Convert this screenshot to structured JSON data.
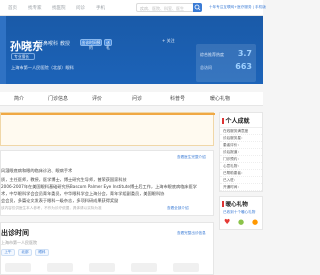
{
  "nav": {
    "items": [
      "首页",
      "找专家",
      "找医院",
      "问诊",
      "手机"
    ],
    "search_placeholder": "疾病、医院、科室、医生",
    "right_links": "十年专注互联网+医疗服务 | 手机版"
  },
  "header": {
    "name": "孙晓东",
    "dept": "耳鼻喉科",
    "title": "教授",
    "badge_visit": "出诊时间预约",
    "badge_gift": "送礼",
    "specialty": "专业擅长",
    "hospital": "上海市第一人民医院（北部）眼科",
    "focus_label": "关注",
    "stats": [
      {
        "label": "综合推荐热度",
        "value": "3.7"
      },
      {
        "label": "总访问",
        "value": "663"
      }
    ]
  },
  "tabs": [
    "简介",
    "门诊信息",
    "评价",
    "问诊",
    "科普号",
    "暖心礼物"
  ],
  "intro": {
    "more": "查看医生完整介绍",
    "lines": [
      "风湿眼底病和眼的临床诊治、眼病手术",
      "质，主任医师，教授，医学博士，博士研究生导师，曾荣获国家科技",
      "2006-2007年在美国眼科基础研究所Bascom Palmer Eye Institute博士后工作，上海市眼底病临床医学",
      "术，中华眼科学会会员青年委员，中华眼科学会上海分会，青年学组副委员，美国眼科协",
      "会会员，多篇论文发表于眼科一级杂志，多项科研成果获得奖励"
    ],
    "faint": "该内容仅供医生本人参考，不作为诊疗依据，具体请以实际为准",
    "more2": "查看全部介绍"
  },
  "side": {
    "card_title": "个人成就",
    "rows": [
      "在线服务满意度",
      "诊后服务星：",
      "患者评价：",
      "诊后报道：",
      "门诊预约：",
      "心意礼物：",
      "已帮助患者：",
      "已入驻：",
      "开通时间："
    ],
    "gift_title": "暖心礼物",
    "gift_sub": "已收到十个暖心礼物"
  },
  "schedule": {
    "title": "出诊时间",
    "more": "查看完整出诊信息",
    "sub": "上海市第一人民医院",
    "chips": [
      "上午",
      "北部",
      "眼科"
    ]
  },
  "colors": {
    "banner": "#1c63b8",
    "accent": "#3a7bd5",
    "notice_bar": "#f0a844",
    "heart": "#e53935"
  }
}
